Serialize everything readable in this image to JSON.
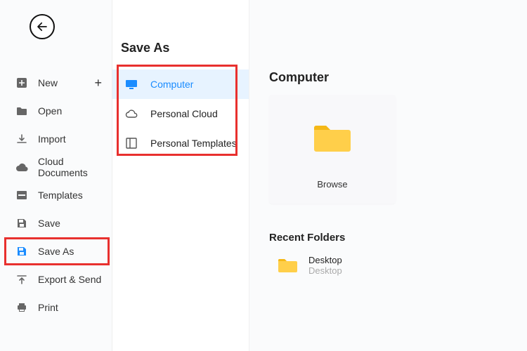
{
  "sidebar": {
    "items": [
      {
        "label": "New"
      },
      {
        "label": "Open"
      },
      {
        "label": "Import"
      },
      {
        "label": "Cloud Documents"
      },
      {
        "label": "Templates"
      },
      {
        "label": "Save"
      },
      {
        "label": "Save As"
      },
      {
        "label": "Export & Send"
      },
      {
        "label": "Print"
      }
    ],
    "active_index": 6
  },
  "panel": {
    "title": "Save As",
    "locations": [
      {
        "label": "Computer",
        "active": true
      },
      {
        "label": "Personal Cloud"
      },
      {
        "label": "Personal Templates"
      }
    ]
  },
  "content": {
    "title": "Computer",
    "browse_label": "Browse",
    "recent_heading": "Recent Folders",
    "recent": [
      {
        "name": "Desktop",
        "path": "Desktop"
      }
    ]
  },
  "highlights": [
    "menu-save-as",
    "location-list"
  ],
  "colors": {
    "accent": "#1a8cff",
    "highlight_border": "#e8302e",
    "folder": "#ffcf4a"
  }
}
